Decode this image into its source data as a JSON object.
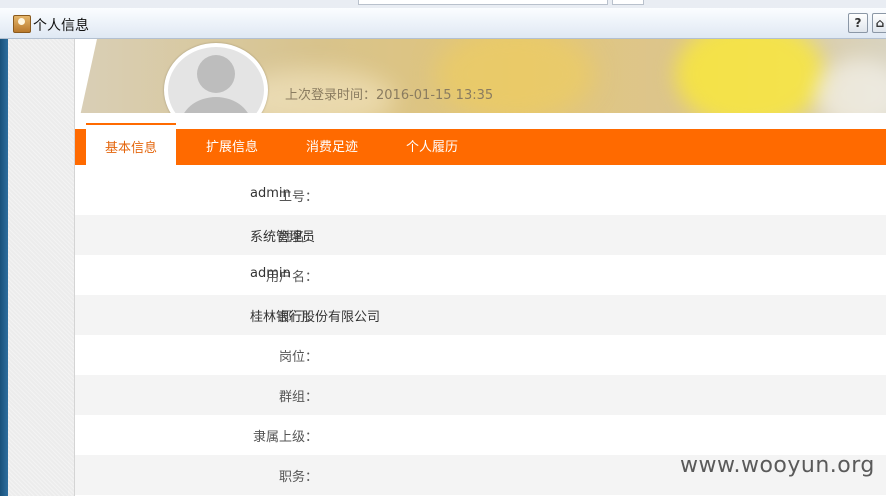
{
  "dialog": {
    "title": "个人信息",
    "help_label": "?",
    "home_label": "⌂"
  },
  "header": {
    "last_login": "上次登录时间：2016-01-15 13:35"
  },
  "tabs": [
    {
      "label": "基本信息",
      "active": true
    },
    {
      "label": "扩展信息",
      "active": false
    },
    {
      "label": "消费足迹",
      "active": false
    },
    {
      "label": "个人履历",
      "active": false
    }
  ],
  "fields": [
    {
      "label": "工号：",
      "value": "admin"
    },
    {
      "label": "姓名：",
      "value": "系统管理员"
    },
    {
      "label": "用户名：",
      "value": "admin"
    },
    {
      "label": "部门：",
      "value": "桂林银行股份有限公司"
    },
    {
      "label": "岗位：",
      "value": ""
    },
    {
      "label": "群组：",
      "value": ""
    },
    {
      "label": "隶属上级：",
      "value": ""
    },
    {
      "label": "职务：",
      "value": ""
    }
  ],
  "watermark": "www.wooyun.org",
  "colors": {
    "accent": "#ff6a00",
    "active_tab_text": "#e4660d"
  },
  "icons": {
    "title": "contact-card-icon",
    "help": "help-icon",
    "home": "home-icon"
  }
}
